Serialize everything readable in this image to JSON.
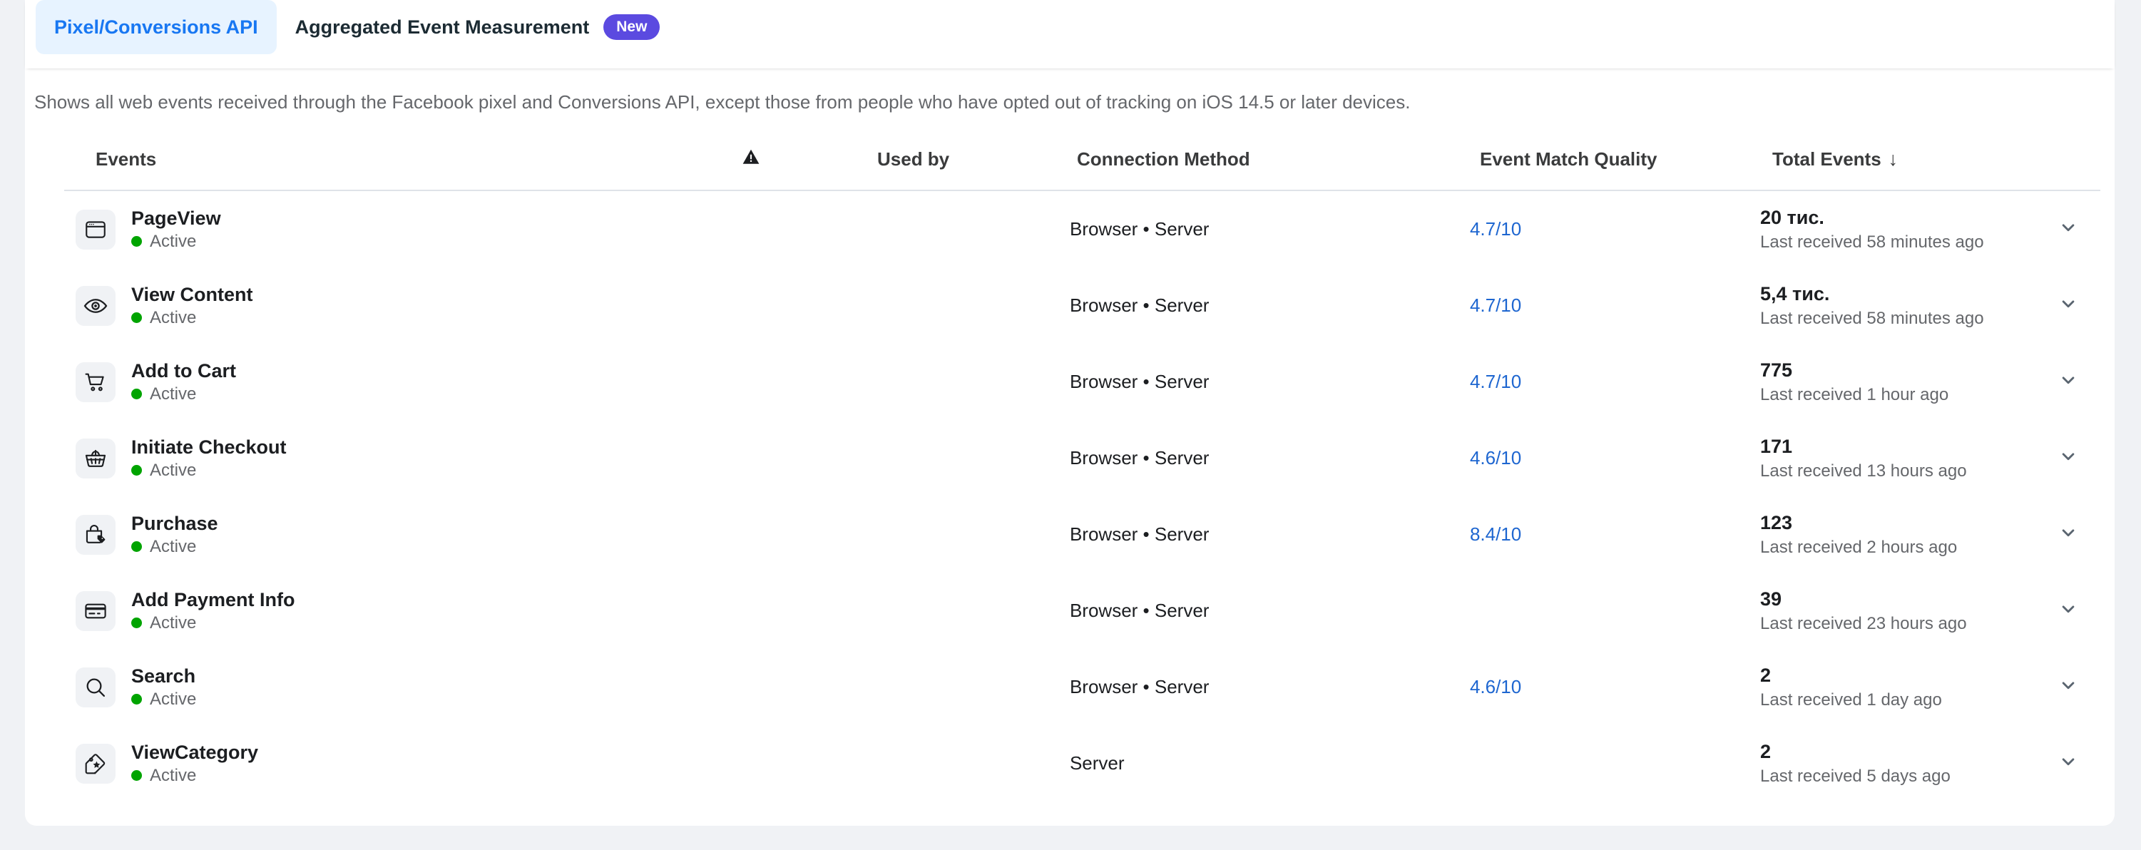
{
  "tabs": [
    {
      "label": "Pixel/Conversions API",
      "active": true,
      "badge": null
    },
    {
      "label": "Aggregated Event Measurement",
      "active": false,
      "badge": "New"
    }
  ],
  "description": "Shows all web events received through the Facebook pixel and Conversions API, except those from people who have opted out of tracking on iOS 14.5 or later devices.",
  "table": {
    "headers": {
      "events": "Events",
      "warning": "warning-icon",
      "used_by": "Used by",
      "connection_method": "Connection Method",
      "event_match_quality": "Event Match Quality",
      "total_events": "Total Events",
      "sort_arrow": "↓"
    },
    "rows": [
      {
        "icon": "browser-window-icon",
        "name": "PageView",
        "status": "Active",
        "used_by": "",
        "connection_method": "Browser • Server",
        "event_match_quality": "4.7/10",
        "total_events": "20 тис.",
        "last_received": "Last received 58 minutes ago"
      },
      {
        "icon": "eye-icon",
        "name": "View Content",
        "status": "Active",
        "used_by": "",
        "connection_method": "Browser • Server",
        "event_match_quality": "4.7/10",
        "total_events": "5,4 тис.",
        "last_received": "Last received 58 minutes ago"
      },
      {
        "icon": "shopping-cart-icon",
        "name": "Add to Cart",
        "status": "Active",
        "used_by": "",
        "connection_method": "Browser • Server",
        "event_match_quality": "4.7/10",
        "total_events": "775",
        "last_received": "Last received 1 hour ago"
      },
      {
        "icon": "shopping-basket-icon",
        "name": "Initiate Checkout",
        "status": "Active",
        "used_by": "",
        "connection_method": "Browser • Server",
        "event_match_quality": "4.6/10",
        "total_events": "171",
        "last_received": "Last received 13 hours ago"
      },
      {
        "icon": "shopping-bag-tag-icon",
        "name": "Purchase",
        "status": "Active",
        "used_by": "",
        "connection_method": "Browser • Server",
        "event_match_quality": "8.4/10",
        "total_events": "123",
        "last_received": "Last received 2 hours ago"
      },
      {
        "icon": "credit-card-icon",
        "name": "Add Payment Info",
        "status": "Active",
        "used_by": "",
        "connection_method": "Browser • Server",
        "event_match_quality": "",
        "total_events": "39",
        "last_received": "Last received 23 hours ago"
      },
      {
        "icon": "magnifier-icon",
        "name": "Search",
        "status": "Active",
        "used_by": "",
        "connection_method": "Browser • Server",
        "event_match_quality": "4.6/10",
        "total_events": "2",
        "last_received": "Last received 1 day ago"
      },
      {
        "icon": "price-tag-star-icon",
        "name": "ViewCategory",
        "status": "Active",
        "used_by": "",
        "connection_method": "Server",
        "event_match_quality": "",
        "total_events": "2",
        "last_received": "Last received 5 days ago"
      }
    ]
  },
  "colors": {
    "accent_blue": "#1877f2",
    "link_blue": "#1e66d0",
    "badge_purple": "#5b4ae0",
    "status_green": "#00a400",
    "page_background": "#f0f2f5",
    "card_background": "#ffffff",
    "text_primary": "#1c1e21",
    "text_secondary": "#65676b"
  }
}
